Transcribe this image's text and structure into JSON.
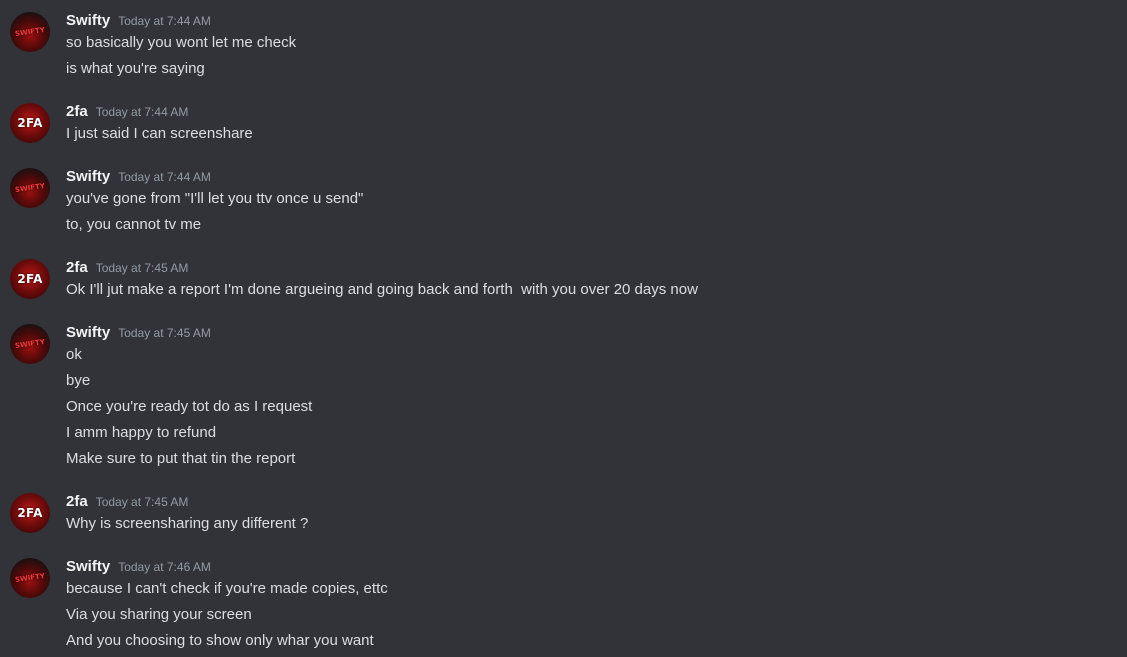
{
  "messages": [
    {
      "author": "Swifty",
      "avatar_text": "SWIFTY",
      "timestamp": "Today at 7:44 AM",
      "lines": [
        "so basically you wont let me check",
        "is what you're saying"
      ]
    },
    {
      "author": "2fa",
      "avatar_text": "2FA",
      "timestamp": "Today at 7:44 AM",
      "lines": [
        "I just said I can screenshare"
      ]
    },
    {
      "author": "Swifty",
      "avatar_text": "SWIFTY",
      "timestamp": "Today at 7:44 AM",
      "lines": [
        "you've gone from \"I'll let you ttv once u send\"",
        "to, you cannot tv me"
      ]
    },
    {
      "author": "2fa",
      "avatar_text": "2FA",
      "timestamp": "Today at 7:45 AM",
      "lines": [
        "Ok I'll jut make a report I'm done argueing and going back and forth  with you over 20 days now"
      ]
    },
    {
      "author": "Swifty",
      "avatar_text": "SWIFTY",
      "timestamp": "Today at 7:45 AM",
      "lines": [
        "ok",
        "bye",
        "Once you're ready tot do as I request",
        "I amm happy to refund",
        "Make sure to put that tin the report"
      ]
    },
    {
      "author": "2fa",
      "avatar_text": "2FA",
      "timestamp": "Today at 7:45 AM",
      "lines": [
        "Why is screensharing any different ?"
      ]
    },
    {
      "author": "Swifty",
      "avatar_text": "SWIFTY",
      "timestamp": "Today at 7:46 AM",
      "lines": [
        "because I can't check if you're made copies, ettc",
        "Via you sharing your screen",
        "And you choosing to show only whar you want"
      ]
    }
  ]
}
